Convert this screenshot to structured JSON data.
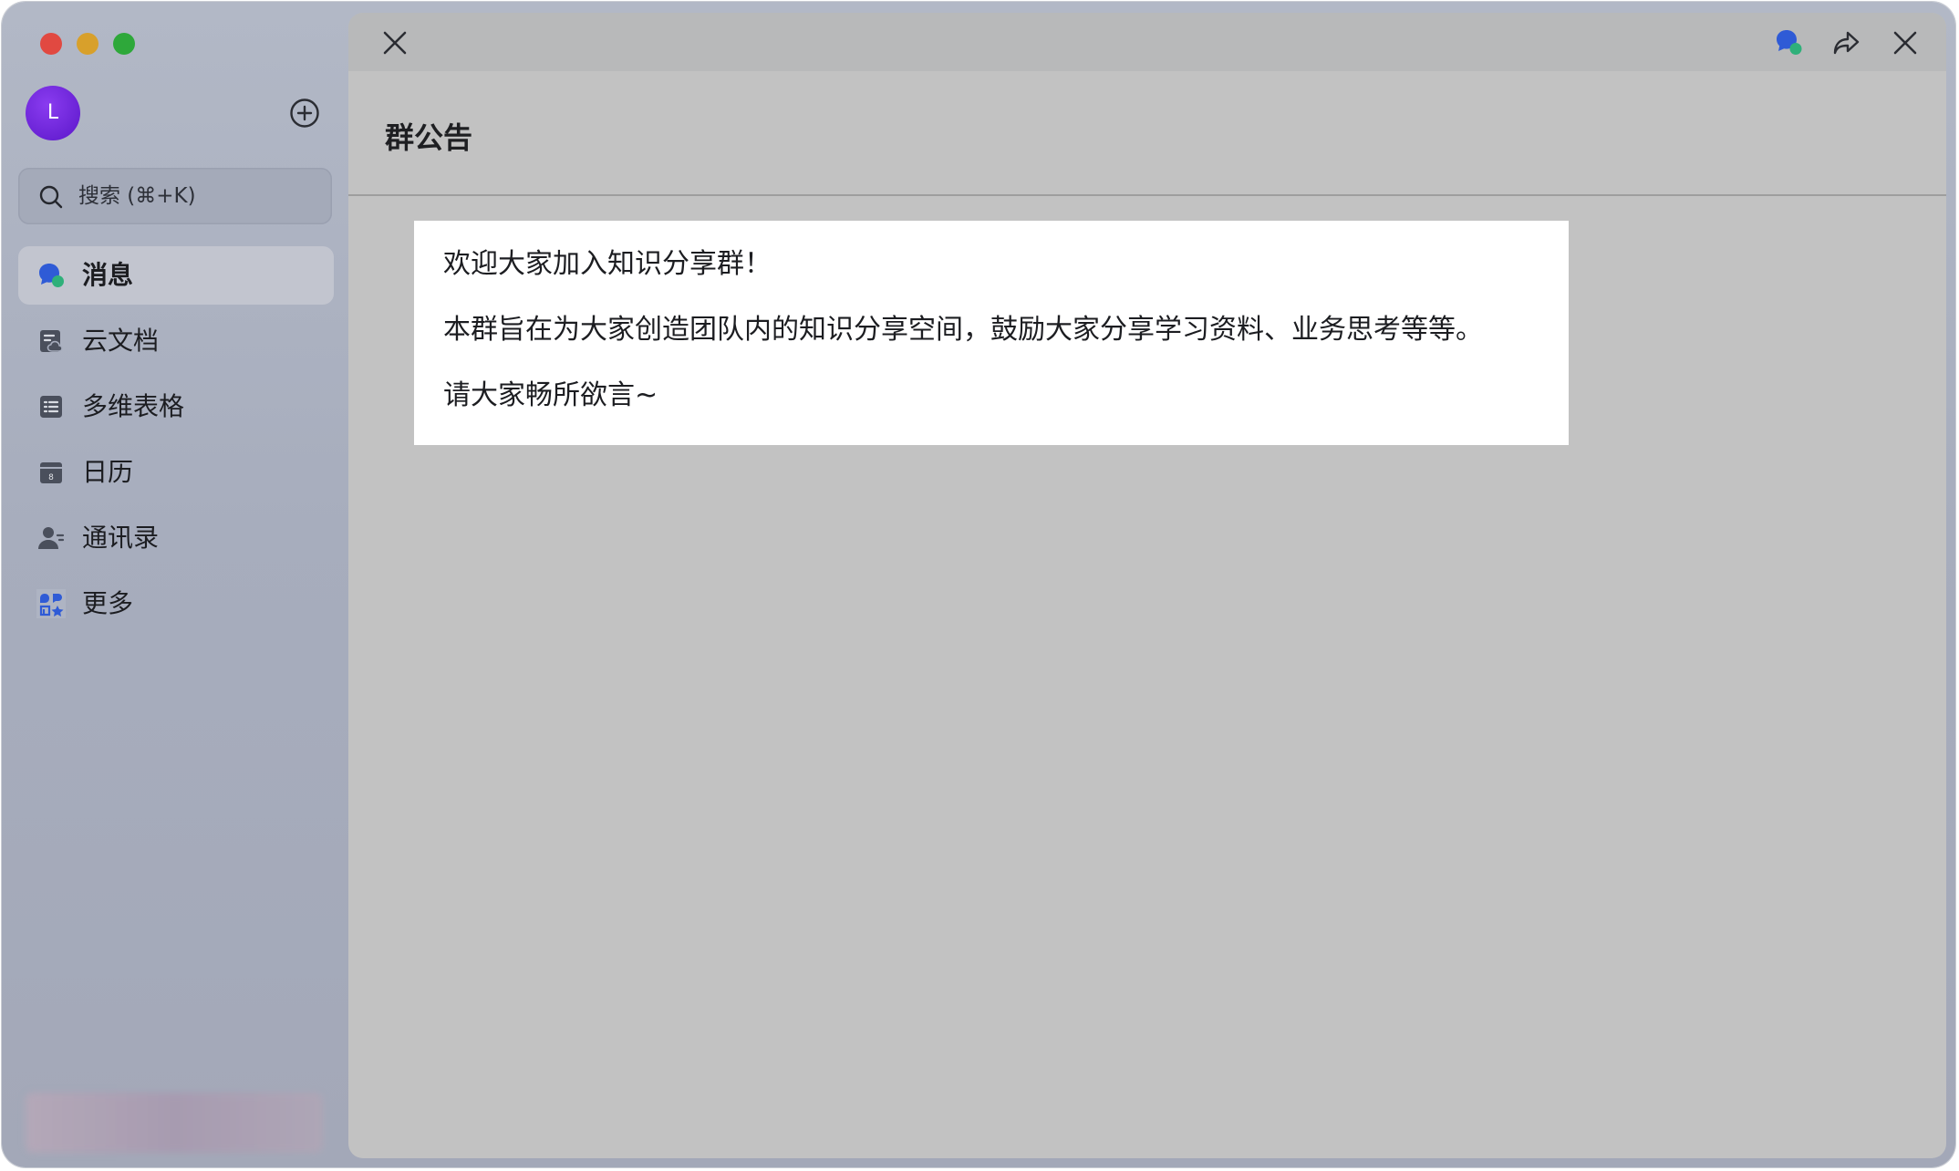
{
  "sidebar": {
    "avatar_initial": "L",
    "search_placeholder": "搜索 (⌘+K)",
    "items": [
      {
        "label": "消息",
        "icon": "chat-bubble-icon",
        "active": true
      },
      {
        "label": "云文档",
        "icon": "cloud-doc-icon"
      },
      {
        "label": "多维表格",
        "icon": "table-icon"
      },
      {
        "label": "日历",
        "icon": "calendar-icon",
        "calendar_day": "8"
      },
      {
        "label": "通讯录",
        "icon": "contacts-icon"
      },
      {
        "label": "更多",
        "icon": "apps-grid-icon"
      }
    ]
  },
  "main": {
    "title": "群公告",
    "announcement": {
      "lines": [
        "欢迎大家加入知识分享群！",
        "本群旨在为大家创造团队内的知识分享空间，鼓励大家分享学习资料、业务思考等等。",
        "请大家畅所欲言~"
      ]
    }
  },
  "colors": {
    "accent_blue": "#2f5bd6",
    "accent_green": "#2fb07a",
    "avatar_purple": "#6a20d8"
  }
}
